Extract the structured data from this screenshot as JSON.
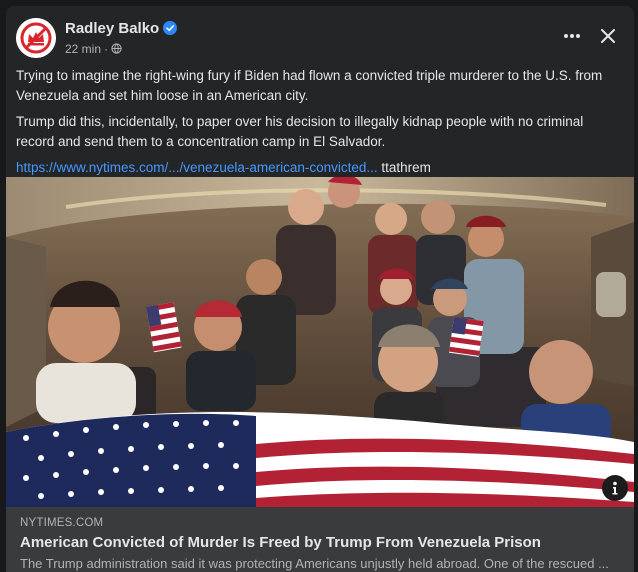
{
  "post": {
    "author": "Radley Balko",
    "time": "22 min",
    "separator": "·",
    "paragraph1": "Trying to imagine the right-wing fury if Biden had flown a convicted triple murderer to the U.S. from Venezuela and set him loose in an American city.",
    "paragraph2": "Trump did this, incidentally, to paper over his decision to illegally kidnap people with no criminal record and send them to a concentration  camp in El Salvador.",
    "link_text": "https://www.nytimes.com/.../venezuela-american-convicted...",
    "link_suffix": " ttathrem"
  },
  "preview": {
    "domain": "NYTIMES.COM",
    "headline": "American Convicted of Murder Is Freed by Trump From Venezuela Prison",
    "description": "The Trump administration said it was protecting Americans unjustly held abroad. One of the rescued ..."
  },
  "icons": {
    "verified": "verified-badge-icon",
    "globe": "globe-icon",
    "more": "more-options-icon",
    "close": "close-icon",
    "info": "info-icon"
  },
  "colors": {
    "background": "#18191a",
    "card": "#242526",
    "link": "#4599ff",
    "verified": "#2d88ff"
  }
}
